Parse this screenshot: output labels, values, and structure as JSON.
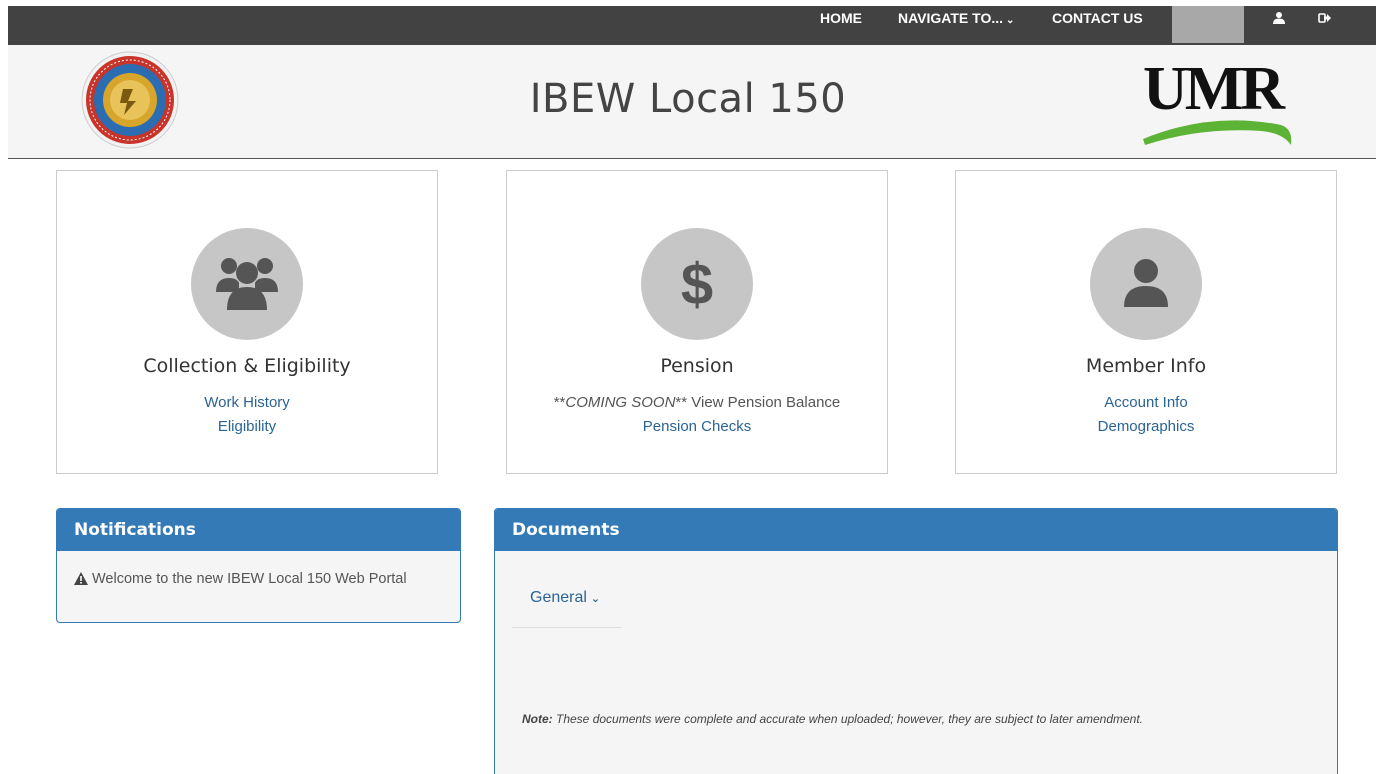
{
  "nav": {
    "home": "HOME",
    "navigate": "NAVIGATE TO...",
    "contact": "CONTACT US"
  },
  "header": {
    "title": "IBEW Local 150",
    "umr_logo_text": "UMR",
    "seal_text": "INTERNATIONAL BROTHERHOOD OF ELECTRICAL WORKERS"
  },
  "cards": [
    {
      "title": "Collection & Eligibility",
      "icon": "users-icon",
      "links": [
        "Work History",
        "Eligibility"
      ]
    },
    {
      "title": "Pension",
      "icon": "dollar-icon",
      "note_prefix": "**",
      "note_italic": "COMING SOON",
      "note_suffix": "** View Pension Balance",
      "links": [
        "Pension Checks"
      ]
    },
    {
      "title": "Member Info",
      "icon": "user-icon",
      "links": [
        "Account Info",
        "Demographics"
      ]
    }
  ],
  "notifications": {
    "title": "Notifications",
    "message": "Welcome to the new IBEW Local 150 Web Portal"
  },
  "documents": {
    "title": "Documents",
    "tab": "General",
    "note_label": "Note:",
    "note_text": " These documents were complete and accurate when uploaded; however, they are subject to later amendment."
  },
  "colors": {
    "topbar": "#424242",
    "panel_header": "#337ab7",
    "link": "#2a6496",
    "icon_circle": "#c6c6c6"
  }
}
